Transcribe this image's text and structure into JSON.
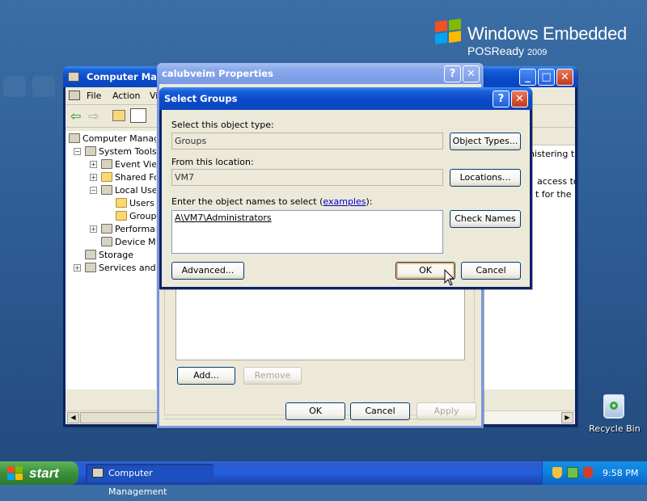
{
  "desktop": {
    "brand_line1": "Windows Embedded",
    "brand_line2": "POSReady",
    "brand_year": "2009",
    "recycle_bin_label": "Recycle Bin"
  },
  "computer_management": {
    "title": "Computer Manag",
    "menu": [
      "File",
      "Action",
      "Vi"
    ],
    "tree": [
      "Computer Manage",
      "System Tools",
      "Event View",
      "Shared Fo",
      "Local User",
      "Users",
      "Groups",
      "Performan",
      "Device Ma",
      "Storage",
      "Services and A"
    ],
    "right_text": [
      "nistering th",
      "access to",
      "t for the H"
    ]
  },
  "properties": {
    "title": "calubveim Properties",
    "add_label": "Add...",
    "remove_label": "Remove",
    "ok_label": "OK",
    "cancel_label": "Cancel",
    "apply_label": "Apply"
  },
  "select_groups": {
    "title": "Select Groups",
    "object_type_label": "Select this object type:",
    "object_type_value": "Groups",
    "object_types_button": "Object Types...",
    "location_label": "From this location:",
    "location_value": "VM7",
    "locations_button": "Locations...",
    "names_label_pre": "Enter the object names to select (",
    "names_label_link": "examples",
    "names_label_post": "):",
    "names_value": "A\\VM7\\Administrators",
    "check_names_button": "Check Names",
    "advanced_button": "Advanced...",
    "ok_button": "OK",
    "cancel_button": "Cancel"
  },
  "taskbar": {
    "start_label": "start",
    "task_label": "Computer Management",
    "clock": "9:58 PM"
  },
  "colors": {
    "desktop": "#2f5f97",
    "title_active": "#0a4bc8",
    "dialog_face": "#ece9d8",
    "start_green": "#3c8f3c"
  }
}
